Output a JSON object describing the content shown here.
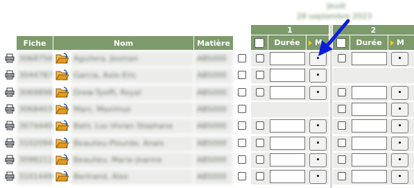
{
  "date_header": {
    "day": "Jeudi",
    "date": "28 septembre 2023"
  },
  "columns": {
    "fiche": "Fiche",
    "nom": "Nom",
    "matiere": "Matière"
  },
  "sessions": [
    {
      "number": "1",
      "duree_label": "Durée",
      "m_label": "M"
    },
    {
      "number": "2",
      "duree_label": "Durée",
      "m_label": "M"
    }
  ],
  "dot_label": "•",
  "rows": [
    {
      "id": "3068758",
      "name": "Aguilera, Jesman",
      "matiere": "ABS000",
      "s1": true,
      "s2": true
    },
    {
      "id": "3044787",
      "name": "Garcia, Axle-Eric",
      "matiere": "ABS000",
      "s1": true,
      "s2": false
    },
    {
      "id": "3069898",
      "name": "Drew-Tyeffi, Royal",
      "matiere": "ABS000",
      "s1": true,
      "s2": true
    },
    {
      "id": "3068403",
      "name": "Marc, Maximus",
      "matiere": "ABS000",
      "s1": false,
      "s2": true
    },
    {
      "id": "3074440",
      "name": "Bahl, Luc-Vivian Stephane",
      "matiere": "ABS000",
      "s1": true,
      "s2": true
    },
    {
      "id": "3102094",
      "name": "Beaulieu-Plourde, Anais",
      "matiere": "ABS000",
      "s1": true,
      "s2": true
    },
    {
      "id": "3098211",
      "name": "Beaulieu, Marie-Joanne",
      "matiere": "ABS000",
      "s1": true,
      "s2": true
    },
    {
      "id": "3101449",
      "name": "Bertrand, Alex",
      "matiere": "ABS000",
      "s1": true,
      "s2": true
    }
  ],
  "colors": {
    "header_green": "#7d9a6b",
    "arrow_blue": "#0a1edb",
    "folder_orange": "#e39a1d"
  }
}
